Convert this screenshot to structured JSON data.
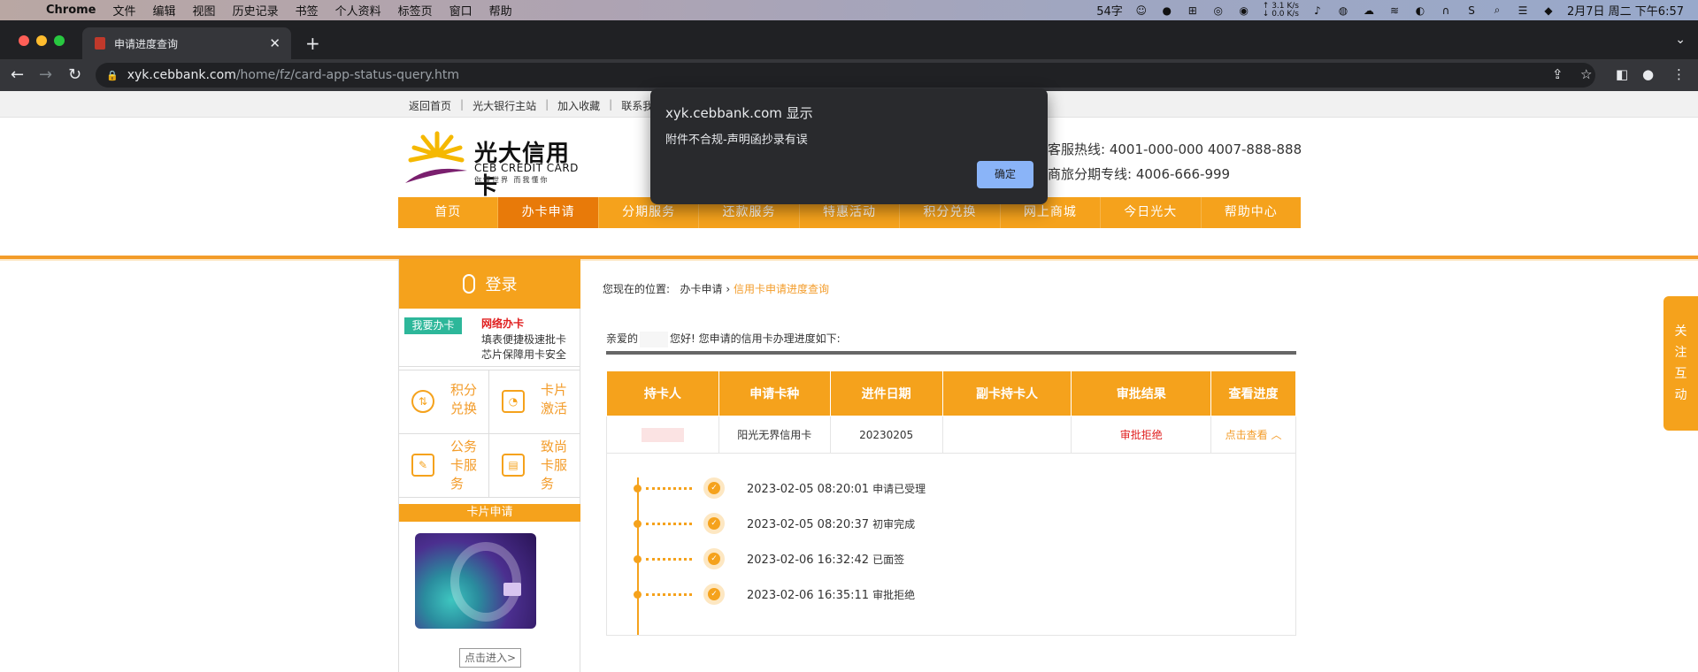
{
  "menubar": {
    "app": "Chrome",
    "items": [
      "文件",
      "编辑",
      "视图",
      "历史记录",
      "书签",
      "个人资料",
      "标签页",
      "窗口",
      "帮助"
    ],
    "word_count": "54字",
    "speed_up": "↑ 3.1 K/s",
    "speed_down": "↓ 0.0 K/s",
    "datetime": "2月7日 周二 下午6:57"
  },
  "browser": {
    "tab_title": "申请进度查询",
    "url_host": "xyk.cebbank.com",
    "url_path": "/home/fz/card-app-status-query.htm"
  },
  "toplinks": [
    "返回首页",
    "光大银行主站",
    "加入收藏",
    "联系我"
  ],
  "logo": {
    "cn": "光大信用卡",
    "en": "CEB CREDIT CARD",
    "slogan": "你懂世界 而我懂你"
  },
  "hotline": {
    "line1": "客服热线:  4001-000-000    4007-888-888",
    "line2": "商旅分期专线:  4006-666-999"
  },
  "nav": [
    "首页",
    "办卡申请",
    "分期服务",
    "还款服务",
    "特惠活动",
    "积分兑换",
    "网上商城",
    "今日光大",
    "帮助中心"
  ],
  "sidebar": {
    "login": "登录",
    "apply_btn": "我要办卡",
    "apply_title": "网络办卡",
    "apply_line1": "填表便捷极速批卡",
    "apply_line2": "芯片保障用卡安全",
    "grid": [
      {
        "icon": "points-icon",
        "label": "积分兑换"
      },
      {
        "icon": "card-activate-icon",
        "label": "卡片激活"
      },
      {
        "icon": "business-card-icon",
        "label": "公务卡服务"
      },
      {
        "icon": "premium-card-icon",
        "label": "致尚卡服务"
      }
    ],
    "card_head": "卡片申请",
    "enter": "点击进入>"
  },
  "main": {
    "crumb_prefix": "您现在的位置:",
    "crumb_parent": "办卡申请",
    "crumb_current": "信用卡申请进度查询",
    "greet_pre": "亲爱的",
    "greet_post": "您好!  您申请的信用卡办理进度如下:",
    "table": {
      "headers": [
        "持卡人",
        "申请卡种",
        "进件日期",
        "副卡持卡人",
        "审批结果",
        "查看进度"
      ],
      "row": {
        "holder": "",
        "card": "阳光无界信用卡",
        "date": "20230205",
        "sub": "",
        "result": "审批拒绝",
        "view": "点击查看"
      }
    },
    "steps": [
      {
        "time": "2023-02-05 08:20:01",
        "label": "申请已受理"
      },
      {
        "time": "2023-02-05 08:20:37",
        "label": "初审完成"
      },
      {
        "time": "2023-02-06 16:32:42",
        "label": "已面签"
      },
      {
        "time": "2023-02-06 16:35:11",
        "label": "审批拒绝"
      }
    ]
  },
  "follow_tab": [
    "关",
    "注",
    "互",
    "动"
  ],
  "dialog": {
    "title": "xyk.cebbank.com 显示",
    "message": "附件不合规-声明函抄录有误",
    "ok": "确定"
  }
}
